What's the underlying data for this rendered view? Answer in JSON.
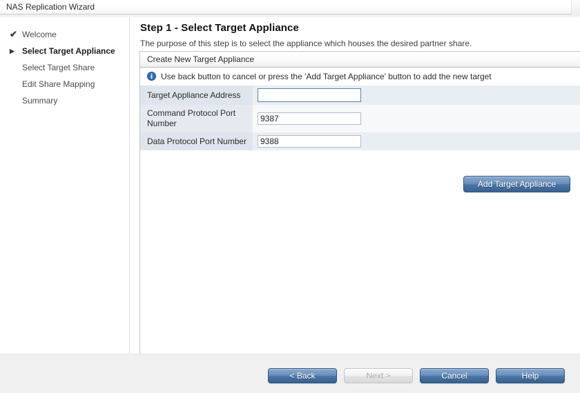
{
  "window": {
    "title": "NAS Replication Wizard"
  },
  "sidebar": {
    "items": [
      {
        "label": "Welcome",
        "marker": "check",
        "glyph": "✔",
        "state": "completed"
      },
      {
        "label": "Select Target Appliance",
        "marker": "arrow",
        "glyph": "▶",
        "state": "current"
      },
      {
        "label": "Select Target Share",
        "marker": "none",
        "glyph": "",
        "state": "pending"
      },
      {
        "label": "Edit Share Mapping",
        "marker": "none",
        "glyph": "",
        "state": "pending"
      },
      {
        "label": "Summary",
        "marker": "none",
        "glyph": "",
        "state": "pending"
      }
    ]
  },
  "content": {
    "step_title": "Step 1 - Select Target Appliance",
    "step_description": "The purpose of this step is to select the appliance which houses the desired partner share.",
    "panel": {
      "header": "Create New Target Appliance",
      "info_icon": "info-circle-icon",
      "info_message": "Use back button to cancel or press the 'Add Target Appliance' button to add the new target",
      "fields": [
        {
          "label": "Target Appliance Address",
          "value": "",
          "placeholder": "",
          "focused": true
        },
        {
          "label": "Command Protocol Port Number",
          "value": "9387",
          "placeholder": "",
          "focused": false
        },
        {
          "label": "Data Protocol Port Number",
          "value": "9388",
          "placeholder": "",
          "focused": false
        }
      ],
      "add_button": "Add Target Appliance"
    }
  },
  "footer": {
    "buttons": [
      {
        "label": "< Back",
        "enabled": true
      },
      {
        "label": "Next >",
        "enabled": false
      },
      {
        "label": "Cancel",
        "enabled": true
      },
      {
        "label": "Help",
        "enabled": true
      }
    ]
  },
  "colors": {
    "accent_blue": "#4a75a6",
    "row_odd": "#e9eef3",
    "row_even": "#f7f8fa",
    "label_cell": "#dfe5ec",
    "footer_bg": "#f0f0f0",
    "info_icon_blue": "#2f6fb5"
  }
}
